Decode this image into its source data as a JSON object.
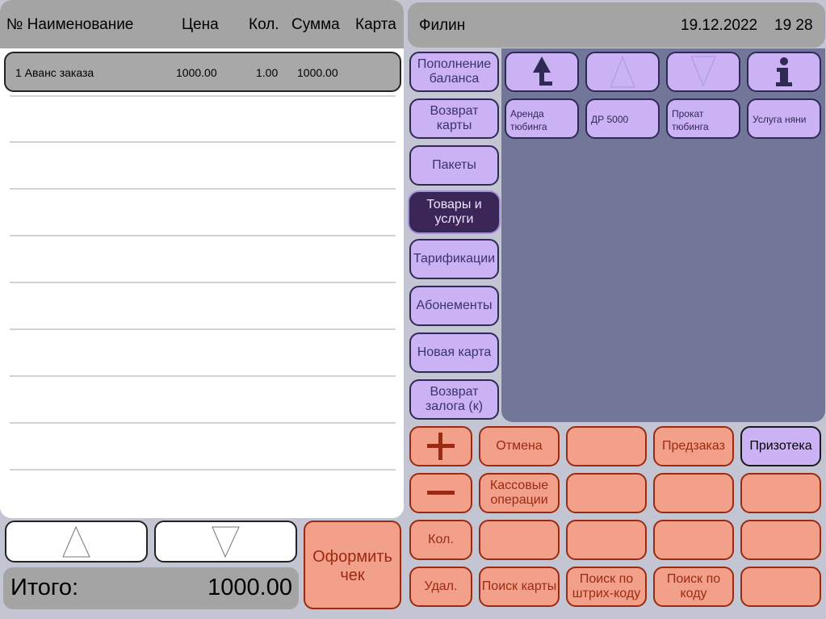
{
  "receipt": {
    "headers": {
      "name": "№ Наименование",
      "price": "Цена",
      "qty": "Кол.",
      "sum": "Сумма",
      "card": "Карта"
    },
    "items": [
      {
        "line": "1 Аванс заказа",
        "price": "1000.00",
        "qty": "1.00",
        "sum": "1000.00",
        "card": ""
      }
    ]
  },
  "total": {
    "label": "Итого:",
    "value": "1000.00"
  },
  "checkout": {
    "label": "Оформить чек"
  },
  "header": {
    "operator": "Филин",
    "date": "19.12.2022",
    "time": "19 28"
  },
  "categories": [
    {
      "label": "Пополнение баланса"
    },
    {
      "label": "Возврат карты"
    },
    {
      "label": "Пакеты"
    },
    {
      "label": "Товары и услуги",
      "active": true
    },
    {
      "label": "Тарификации"
    },
    {
      "label": "Абонементы"
    },
    {
      "label": "Новая карта"
    },
    {
      "label": "Возврат залога (к)"
    }
  ],
  "nav_icons": [
    "up-level-icon",
    "scroll-up-icon",
    "scroll-down-icon",
    "info-icon"
  ],
  "products": [
    {
      "label": "Аренда тюбинга"
    },
    {
      "label": "ДР 5000"
    },
    {
      "label": "Прокат тюбинга"
    },
    {
      "label": "Услуга няни"
    }
  ],
  "functions": {
    "cancel": "Отмена",
    "preorder": "Предзаказ",
    "prizoteka": "Призотека",
    "cash_ops": "Кассовые операции",
    "qty": "Кол.",
    "delete": "Удал.",
    "find_card": "Поиск карты",
    "find_barcode": "Поиск по штрих-коду",
    "find_code": "Поиск по коду"
  },
  "colors": {
    "accent_purple": "#cbb2f5",
    "active_category": "#3b2657",
    "function_key": "#f3a08b",
    "function_text": "#9a2a12",
    "product_area": "#727699"
  }
}
